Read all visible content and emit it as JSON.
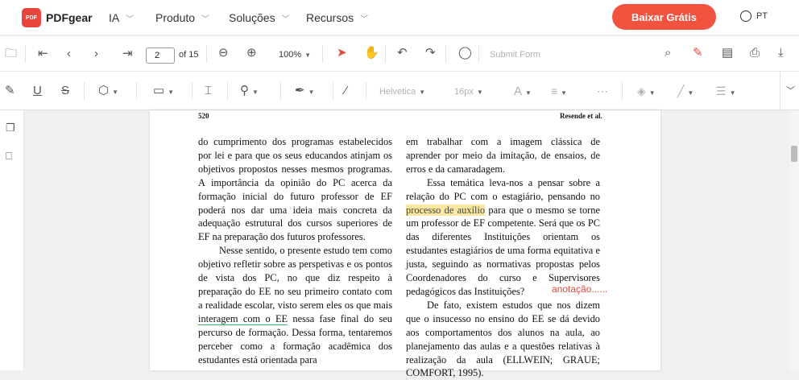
{
  "brand": {
    "name": "PDFgear",
    "mark": "PDF"
  },
  "nav": {
    "menus": [
      "IA",
      "Produto",
      "Soluções",
      "Recursos"
    ],
    "cta": "Baixar Grátis",
    "lang": "PT"
  },
  "toolbar": {
    "page_value": "2",
    "page_total": "of 15",
    "zoom": "100%",
    "submit_form": "Submit Form"
  },
  "format": {
    "font": "Helvetica",
    "size": "16px",
    "font_color_letter": "A"
  },
  "document": {
    "page_number": "520",
    "running_head": "Resende et al.",
    "left_col": {
      "p1": "do cumprimento dos programas estabelecidos por lei e para que os seus educandos atinjam os objetivos propostos nesses mesmos programas. A importância da opinião do PC acerca da formação inicial do futuro professor de EF poderá nos dar uma ideia mais concreta da adequação estrutural dos cursos superiores de EF na preparação dos futuros professores.",
      "p2_a": "Nesse sentido, o presente estudo tem como objetivo refletir sobre as perspetivas e os pontos de vista dos PC, no que diz respeito à preparação do EE no seu primeiro contato com a realidade escolar, visto serem eles os que mais ",
      "p2_ul": "interagem com o EE",
      "p2_b": " nessa fase final do seu percurso de formação. Dessa forma, tentaremos perceber como a formação acadêmica dos estudantes está orientada para"
    },
    "right_col": {
      "p1": "em trabalhar com a imagem clássica de aprender por meio da imitação, de ensaios, de erros e da camaradagem.",
      "p2_a": "Essa temática leva-nos a pensar sobre a relação do PC com o estagiário, pensando no ",
      "p2_hl": "processo de auxílio",
      "p2_b": " para que o mesmo se torne um professor de EF competente. Será que os PC das diferentes Instituições orientam os estudantes estagiários de uma forma equitativa e justa, seguindo as normativas propostas pelos Coordenadores do curso e Supervisores pedagógicos das Instituições?",
      "p3": "De fato, existem estudos que nos dizem que o insucesso no ensino do EE se dá devido aos comportamentos dos alunos na aula, ao planejamento das aulas e a questões relativas à realização da aula (ELLWEIN; GRAUE; COMFORT, 1995)."
    },
    "annotation": "anotação......"
  },
  "colors": {
    "accent": "#f1533f",
    "highlight": "#fbe7a0",
    "underline": "#3fae5e",
    "annotation": "#e24c3d"
  }
}
